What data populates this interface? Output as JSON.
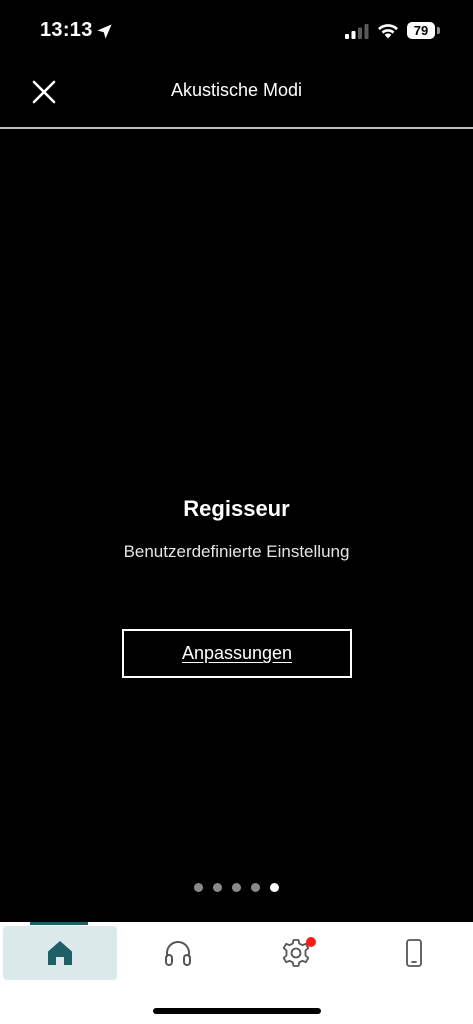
{
  "status_bar": {
    "time": "13:13",
    "battery": "79"
  },
  "header": {
    "title": "Akustische Modi",
    "close_icon": "close-icon"
  },
  "mode": {
    "title": "Regisseur",
    "subtitle": "Benutzerdefinierte Einstellung",
    "button_label": "Anpassungen"
  },
  "pagination": {
    "total": 5,
    "active_index": 4
  },
  "nav": {
    "items": [
      {
        "icon": "home-icon",
        "active": true
      },
      {
        "icon": "headphones-icon",
        "active": false
      },
      {
        "icon": "gear-icon",
        "active": false,
        "badge": true
      },
      {
        "icon": "phone-icon",
        "active": false
      }
    ]
  },
  "colors": {
    "background": "#000000",
    "accent": "#1f5f66",
    "active_nav_bg": "#dbe9ea",
    "badge": "#ff1a1a"
  }
}
